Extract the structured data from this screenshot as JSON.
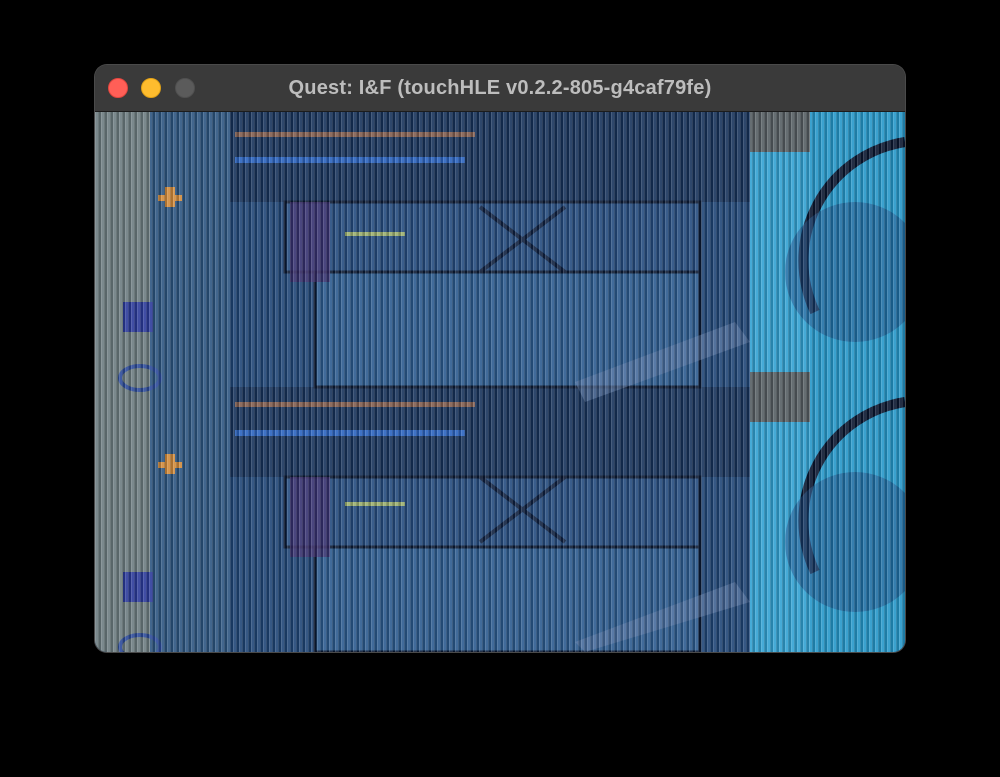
{
  "window": {
    "title": "Quest: I&F (touchHLE v0.2.2-805-g4caf79fe)",
    "controls": [
      "close",
      "minimize",
      "zoom"
    ]
  },
  "viewport": {
    "description_icon": "glitched-game-render",
    "colors": {
      "base_blue": "#1c3e6a",
      "deep_blue": "#0f2341",
      "cyan": "#2aa7d6",
      "light_cyan": "#6fd2ee",
      "navy": "#0a1630",
      "gray": "#7a8a8e",
      "purple": "#3b2a6b"
    }
  }
}
